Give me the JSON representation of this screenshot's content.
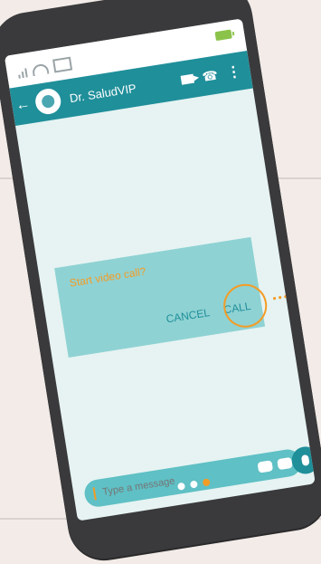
{
  "app": {
    "chat_title": "Dr. SaludVIP",
    "dialog": {
      "title": "Start video call?",
      "cancel_label": "CANCEL",
      "call_label": "CALL"
    },
    "composer": {
      "placeholder": "Type a message"
    }
  },
  "colors": {
    "header": "#1f8f9a",
    "accent": "#f39c26",
    "dialog_bg": "#8fd2d3",
    "composer_bg": "#5fc0c5",
    "screen_bg": "#e6f3f2"
  },
  "icons": {
    "signal": "signal-icon",
    "wifi": "wifi-icon",
    "mail": "mail-icon",
    "battery": "battery-icon",
    "back": "back-arrow-icon",
    "avatar": "avatar-icon",
    "video": "video-call-icon",
    "phone": "phone-icon",
    "menu": "more-vert-icon",
    "clip": "attachment-icon",
    "camera": "camera-icon",
    "mic": "mic-icon"
  }
}
